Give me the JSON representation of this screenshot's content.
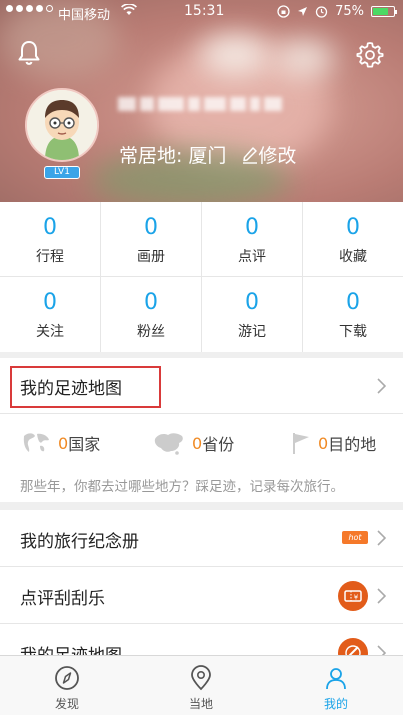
{
  "status_bar": {
    "carrier": "中国移动",
    "time": "15:31",
    "battery": "75%",
    "battery_level": 0.75
  },
  "header": {
    "level_badge": "LV1",
    "residence_label": "常居地:",
    "residence_city": "厦门",
    "edit_label": "修改"
  },
  "stats": [
    {
      "value": "0",
      "label": "行程"
    },
    {
      "value": "0",
      "label": "画册"
    },
    {
      "value": "0",
      "label": "点评"
    },
    {
      "value": "0",
      "label": "收藏"
    },
    {
      "value": "0",
      "label": "关注"
    },
    {
      "value": "0",
      "label": "粉丝"
    },
    {
      "value": "0",
      "label": "游记"
    },
    {
      "value": "0",
      "label": "下载"
    }
  ],
  "footprint": {
    "title": "我的足迹地图",
    "countries_count": "0",
    "countries_label": "国家",
    "provinces_count": "0",
    "provinces_label": "省份",
    "destinations_count": "0",
    "destinations_label": "目的地",
    "description": "那些年，你都去过哪些地方？踩足迹，记录每次旅行。"
  },
  "menu": [
    {
      "label": "我的旅行纪念册",
      "badge": "hot"
    },
    {
      "label": "点评刮刮乐"
    },
    {
      "label": "我的足迹地图"
    }
  ],
  "tabbar": {
    "tabs": [
      {
        "label": "发现"
      },
      {
        "label": "当地"
      },
      {
        "label": "我的"
      }
    ]
  },
  "colors": {
    "accent": "#1aa3e8",
    "highlight": "#d93a3a",
    "orange": "#f08a24"
  },
  "icons": {
    "bell": "bell-icon",
    "gear": "gear-icon",
    "pencil": "pencil-icon",
    "chevron": "chevron-right-icon",
    "compass": "compass-icon",
    "location": "location-pin-icon",
    "person": "person-icon"
  }
}
